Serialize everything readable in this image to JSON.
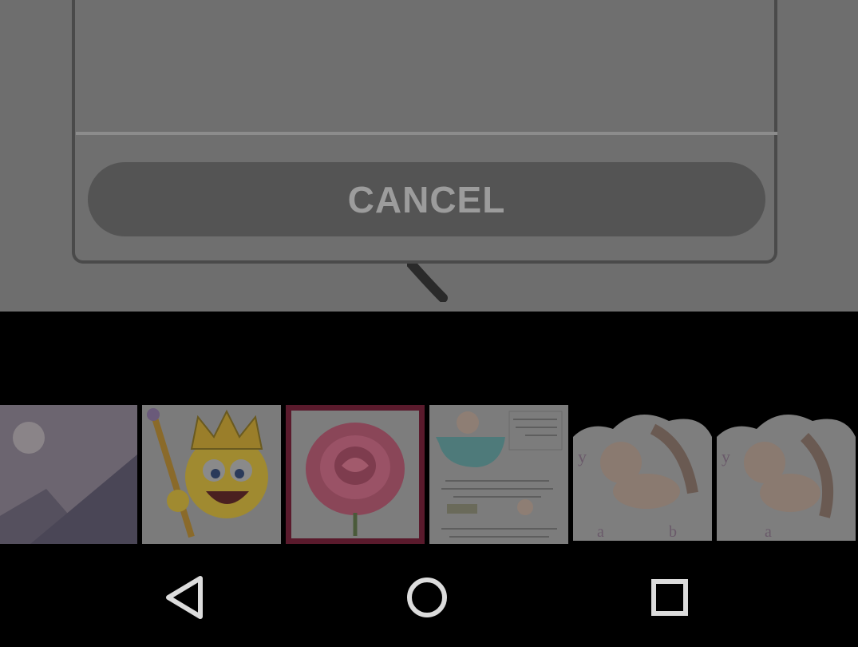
{
  "dialog": {
    "cancel_label": "CANCEL"
  },
  "gallery": {
    "thumbnails": [
      {
        "name": "placeholder-image"
      },
      {
        "name": "king-smiley-image"
      },
      {
        "name": "pink-rose-image"
      },
      {
        "name": "baby-bath-tips-image"
      },
      {
        "name": "baby-massage-image-1"
      },
      {
        "name": "baby-massage-image-2"
      }
    ]
  },
  "navbar": {
    "icons": [
      "back-icon",
      "home-icon",
      "recents-icon"
    ]
  }
}
